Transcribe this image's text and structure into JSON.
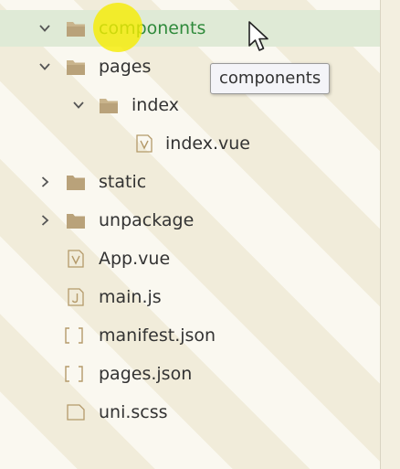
{
  "explorer": {
    "tooltip": "components",
    "items": [
      {
        "label": "components",
        "icon": "folder-icon",
        "chevron": "chevron-down-icon",
        "selected": true
      },
      {
        "label": "pages",
        "icon": "folder-icon",
        "chevron": "chevron-down-icon"
      },
      {
        "label": "index",
        "icon": "folder-icon",
        "chevron": "chevron-down-icon"
      },
      {
        "label": "index.vue",
        "icon": "vue-file-icon"
      },
      {
        "label": "static",
        "icon": "folder-icon",
        "chevron": "chevron-right-icon"
      },
      {
        "label": "unpackage",
        "icon": "folder-icon",
        "chevron": "chevron-right-icon"
      },
      {
        "label": "App.vue",
        "icon": "vue-file-icon"
      },
      {
        "label": "main.js",
        "icon": "js-file-icon"
      },
      {
        "label": "manifest.json",
        "icon": "json-file-icon"
      },
      {
        "label": "pages.json",
        "icon": "json-file-icon"
      },
      {
        "label": "uni.scss",
        "icon": "file-icon"
      }
    ]
  },
  "colors": {
    "background": "#f6f2e3",
    "selected_row": "#dfead6",
    "selected_text": "#2f8a3b",
    "folder_closed": "#b9a27a",
    "folder_open": "#c9b48c",
    "cursor_highlight": "#f6ec00"
  }
}
